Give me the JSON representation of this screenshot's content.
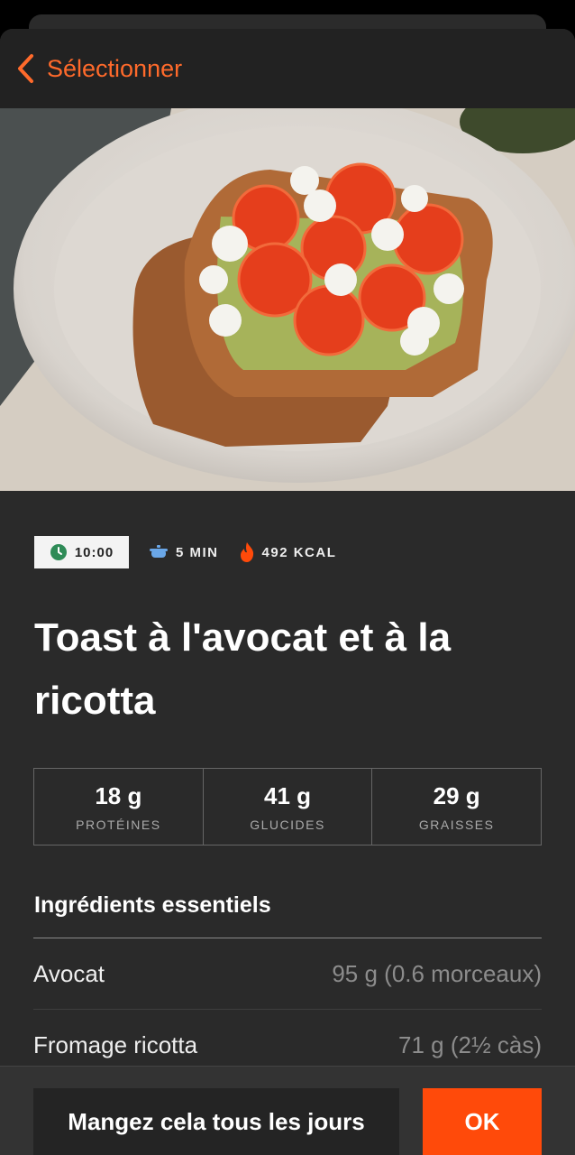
{
  "nav": {
    "back_label": "Sélectionner",
    "back_icon": "chevron-left-icon",
    "accent_color": "#ff6a2b"
  },
  "recipe": {
    "meal_time": "10:00",
    "prep_time": "5 MIN",
    "calories": "492 KCAL",
    "title": "Toast à l'avocat et à la ricotta",
    "image": "avocado-ricotta-toast-photo"
  },
  "macros": [
    {
      "value": "18 g",
      "label": "PROTÉINES"
    },
    {
      "value": "41 g",
      "label": "GLUCIDES"
    },
    {
      "value": "29 g",
      "label": "GRAISSES"
    }
  ],
  "ingredients": {
    "section_title": "Ingrédients essentiels",
    "items": [
      {
        "name": "Avocat",
        "quantity": "95 g (0.6 morceaux)"
      },
      {
        "name": "Fromage ricotta",
        "quantity": "71 g (2½ càs)"
      }
    ]
  },
  "actions": {
    "daily_label": "Mangez cela tous les jours",
    "ok_label": "OK",
    "ok_color": "#ff4a0a"
  }
}
